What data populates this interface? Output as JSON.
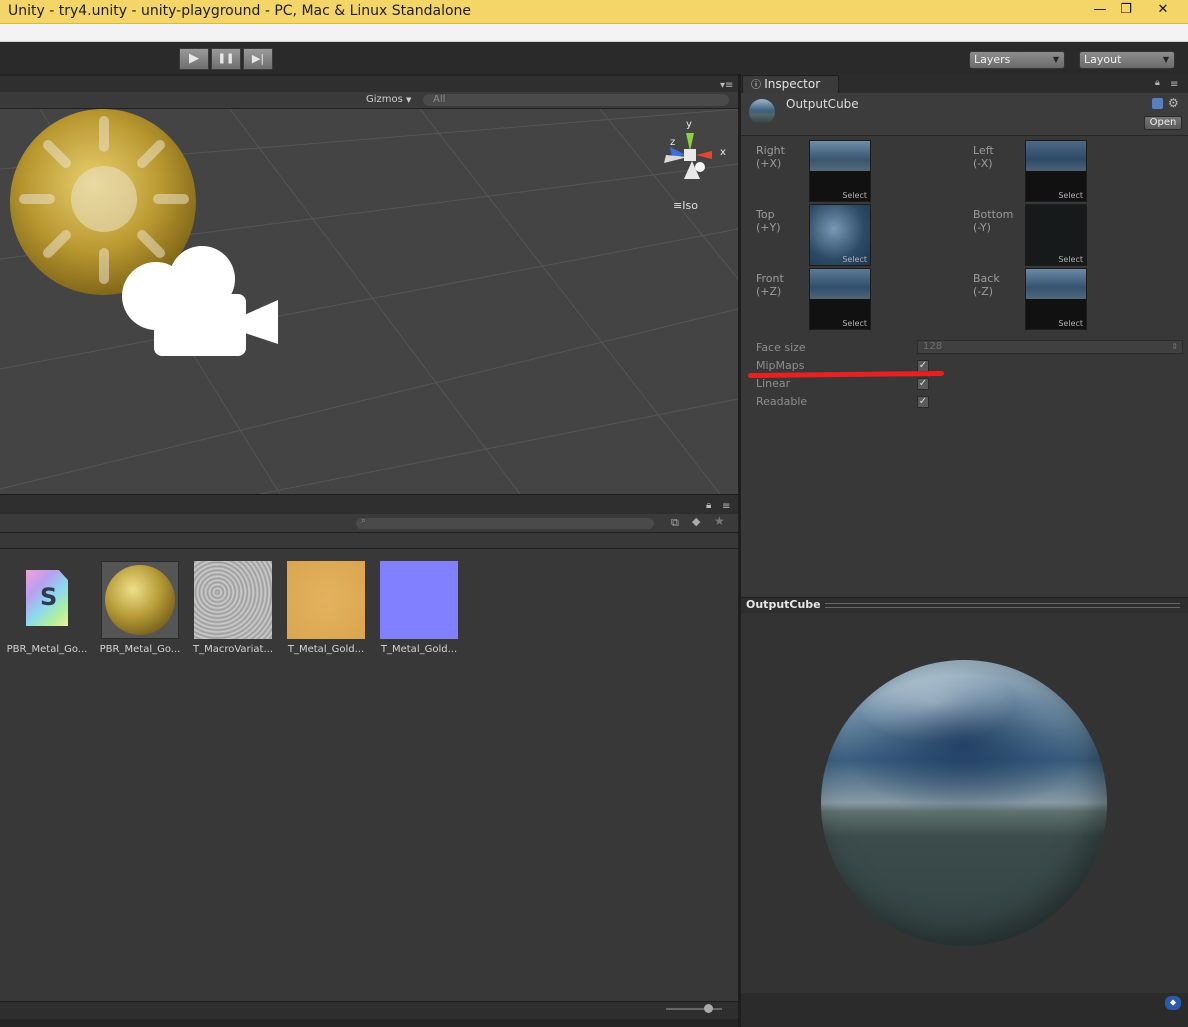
{
  "window": {
    "title": "Unity - try4.unity - unity-playground - PC, Mac & Linux Standalone",
    "minimize": "—",
    "restore": "❐",
    "close": "✕"
  },
  "toolbar": {
    "play": "▶",
    "pause": "❚❚",
    "step": "▶|",
    "layers": "Layers",
    "layout": "Layout"
  },
  "scene": {
    "gizmos": "Gizmos",
    "search_placeholder": "All",
    "iso": "Iso",
    "axes": {
      "x": "x",
      "y": "y",
      "z": "z"
    }
  },
  "project": {
    "assets": [
      {
        "label": "PBR_Metal_Go...",
        "kind": "shader",
        "glyph": "S"
      },
      {
        "label": "PBR_Metal_Go...",
        "kind": "material"
      },
      {
        "label": "T_MacroVariat...",
        "kind": "texture-noise"
      },
      {
        "label": "T_Metal_Gold...",
        "kind": "texture-gold"
      },
      {
        "label": "T_Metal_Gold...",
        "kind": "texture-normal"
      }
    ]
  },
  "inspector": {
    "tab": "Inspector",
    "object_name": "OutputCube",
    "open_button": "Open",
    "select_label": "Select",
    "faces": [
      {
        "name": "Right",
        "axis": "(+X)"
      },
      {
        "name": "Left",
        "axis": "(-X)"
      },
      {
        "name": "Top",
        "axis": "(+Y)"
      },
      {
        "name": "Bottom",
        "axis": "(-Y)"
      },
      {
        "name": "Front",
        "axis": "(+Z)"
      },
      {
        "name": "Back",
        "axis": "(-Z)"
      }
    ],
    "face_size_label": "Face size",
    "face_size_value": "128",
    "mipmaps_label": "MipMaps",
    "linear_label": "Linear",
    "readable_label": "Readable",
    "check": "✓"
  },
  "preview": {
    "title": "OutputCube"
  },
  "colors": {
    "annotation": "#e8201f",
    "title_bar": "#f3d568"
  }
}
